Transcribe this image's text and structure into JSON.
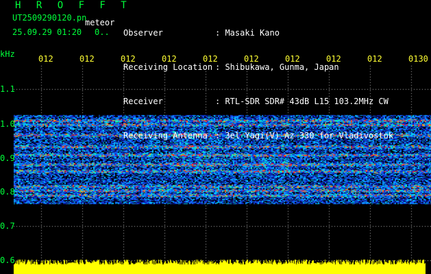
{
  "header": {
    "brand": "H R O F F T",
    "filename": "UT2509290120.pn",
    "meteor_label": "meteor",
    "datetime": "25.09.29 01:20",
    "seconds": "0..",
    "fields": [
      {
        "label": "Observer",
        "value": ": Masaki Kano"
      },
      {
        "label": "Receiving Location",
        "value": ": Shibukawa, Gunma, Japan"
      },
      {
        "label": "Receiver",
        "value": ": RTL-SDR SDR# 43dB L15 103.2MHz CW"
      },
      {
        "label": "Receiving Antenna",
        "value": ": 3el Yagi(V) Az 330 for Vladivostok"
      }
    ]
  },
  "axis": {
    "unit": "kHz",
    "y_ticks": [
      "1.1",
      "1.0",
      "0.9",
      "0.8",
      "0.7",
      "0.6"
    ],
    "time_ticks": [
      "012",
      "012",
      "012",
      "012",
      "012",
      "012",
      "012",
      "012",
      "012",
      "0130"
    ]
  },
  "colors": {
    "background": "#000000",
    "text_green": "#00ff3a",
    "text_white": "#ffffff",
    "text_yellow": "#ffff33",
    "gridline": "#b0b0b0",
    "spectrum_low": "#0a1a8c",
    "spectrum_mid": "#00c8ff",
    "spectrum_high": "#ff2a2a",
    "level_bar": "#ffff00"
  },
  "icons": {
    "spectrogram": "spectrogram-image",
    "level-bar": "signal-level-bar"
  }
}
